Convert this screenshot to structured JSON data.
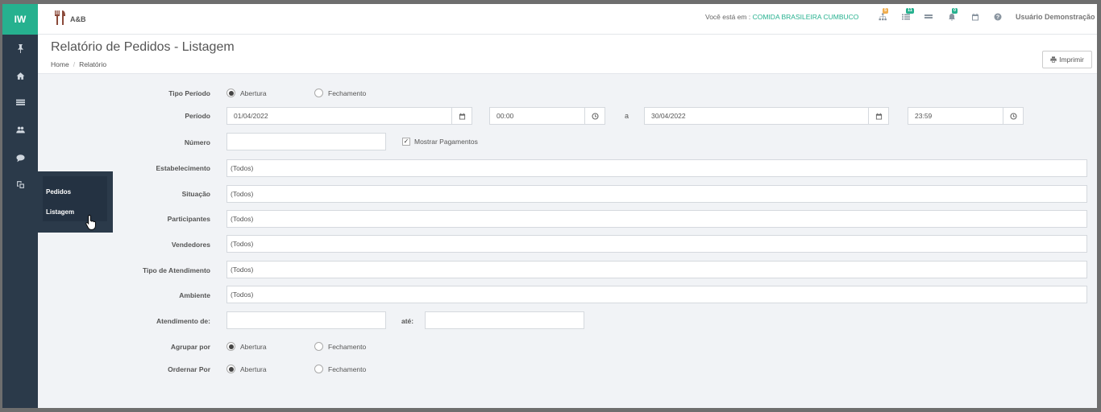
{
  "app": {
    "logo_text": "IW",
    "brand_name": "A&B",
    "location_prefix": "Você está em :",
    "establishment": "COMIDA BRASILEIRA CUMBUCO",
    "user_name": "Usuário Demonstração",
    "accent_color": "#26b18f",
    "sidebar_color": "#2b3a4a"
  },
  "topbar_icons": [
    {
      "icon": "sitemap-icon",
      "badge": "5",
      "badge_color": "#f0ad4e"
    },
    {
      "icon": "list-icon",
      "badge": "11",
      "badge_color": "#26b18f"
    },
    {
      "icon": "server-icon",
      "badge": "",
      "badge_color": ""
    },
    {
      "icon": "bell-icon",
      "badge": "0",
      "badge_color": "#26b18f"
    },
    {
      "icon": "calendar-icon",
      "badge": "",
      "badge_color": ""
    },
    {
      "icon": "help-icon",
      "badge": "",
      "badge_color": ""
    }
  ],
  "sidebar": {
    "icons": [
      "pin-icon",
      "home-icon",
      "table-icon",
      "users-icon",
      "comment-icon",
      "copy-icon"
    ],
    "flyout": {
      "items": [
        "Pedidos",
        "Listagem"
      ]
    }
  },
  "page": {
    "title": "Relatório de Pedidos - Listagem",
    "breadcrumb": [
      "Home",
      "Relatório"
    ],
    "print_label": "Imprimir"
  },
  "form": {
    "tipo_periodo": {
      "label": "Tipo Período",
      "options": [
        "Abertura",
        "Fechamento"
      ],
      "selected": "Abertura"
    },
    "periodo": {
      "label": "Período",
      "date_from": "01/04/2022",
      "time_from": "00:00",
      "separator": "a",
      "date_to": "30/04/2022",
      "time_to": "23:59"
    },
    "numero": {
      "label": "Número",
      "value": "",
      "checkbox_label": "Mostrar Pagamentos",
      "checked": true
    },
    "estabelecimento": {
      "label": "Estabelecimento",
      "value": "(Todos)"
    },
    "situacao": {
      "label": "Situação",
      "value": "(Todos)"
    },
    "participantes": {
      "label": "Participantes",
      "value": "(Todos)"
    },
    "vendedores": {
      "label": "Vendedores",
      "value": "(Todos)"
    },
    "tipo_atendimento": {
      "label": "Tipo de Atendimento",
      "value": "(Todos)"
    },
    "ambiente": {
      "label": "Ambiente",
      "value": "(Todos)"
    },
    "atendimento": {
      "label": "Atendimento de:",
      "from": "",
      "to_label": "até:",
      "to": ""
    },
    "agrupar_por": {
      "label": "Agrupar por",
      "options": [
        "Abertura",
        "Fechamento"
      ],
      "selected": "Abertura"
    },
    "ordenar_por": {
      "label": "Ordernar Por",
      "options": [
        "Abertura",
        "Fechamento"
      ],
      "selected": "Abertura"
    }
  }
}
